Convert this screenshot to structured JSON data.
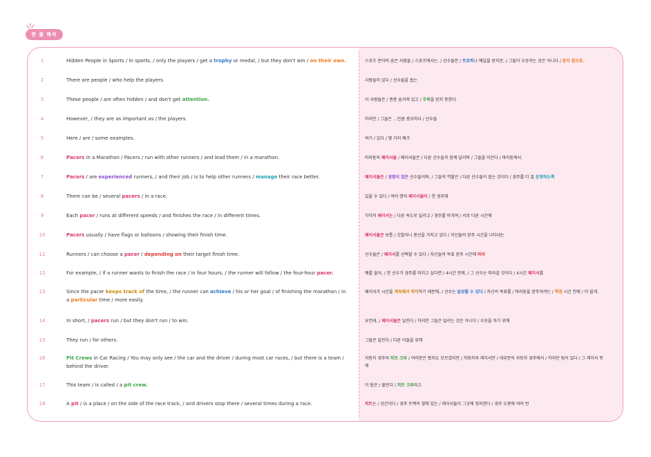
{
  "header": {
    "badge_label": "한 줄 해석"
  },
  "colors": {
    "accent_pink": "#ec8fb3",
    "blue": "#2f78c8",
    "orange": "#f07a1e",
    "green": "#3aa645",
    "pink": "#d9376a",
    "purple": "#8a4ed0",
    "teal": "#1c9fb0",
    "red": "#e03a3a",
    "gold": "#c98a10"
  },
  "rows": [
    {
      "num": "1",
      "en": [
        {
          "t": "Hidden People in Sports / In sports, / only the players / get a "
        },
        {
          "t": "trophy",
          "c": "blue"
        },
        {
          "t": " or medal, / but they don't win / "
        },
        {
          "t": "on their own.",
          "c": "orange"
        }
      ],
      "ko": [
        {
          "t": "스포츠 분야의 숨은 사람들 / 스포츠에서는, / 선수들만 / "
        },
        {
          "t": "트로피",
          "c": "blue"
        },
        {
          "t": "나 메달을 받지만, / 그들이 우승하는 것은 아니다 / "
        },
        {
          "t": "혼자 힘으로.",
          "c": "orange"
        }
      ]
    },
    {
      "num": "2",
      "en": [
        {
          "t": "There are people / who help the players."
        }
      ],
      "ko": [
        {
          "t": "사람들이 있다 / 선수들을 돕는"
        }
      ]
    },
    {
      "num": "3",
      "en": [
        {
          "t": "These people / are often hidden / and don't get "
        },
        {
          "t": "attention.",
          "c": "green"
        }
      ],
      "ko": [
        {
          "t": "이 사람들은 / 종종 숨겨져 있고 / "
        },
        {
          "t": "주목",
          "c": "green"
        },
        {
          "t": "을 받지 못한다."
        }
      ]
    },
    {
      "num": "4",
      "en": [
        {
          "t": "However, / they are as important as / the players."
        }
      ],
      "ko": [
        {
          "t": "하지만 / 그들은 …만큼 중요하다 / 선수들"
        }
      ]
    },
    {
      "num": "5",
      "en": [
        {
          "t": "Here / are / some examples."
        }
      ],
      "ko": [
        {
          "t": "여기 / 있다 / 몇 가지 예가"
        }
      ]
    },
    {
      "num": "6",
      "en": [
        {
          "t": "Pacers",
          "c": "pink"
        },
        {
          "t": " in a Marathon / Pacers / run with other runners / and lead them / in a marathon."
        }
      ],
      "ko": [
        {
          "t": "마라톤의 "
        },
        {
          "t": "페이서들",
          "c": "pink"
        },
        {
          "t": " / 페이서들은 / 다른 선수들과 함께 달리며 / 그들을 이끈다 / 마라톤에서."
        }
      ]
    },
    {
      "num": "7",
      "en": [
        {
          "t": "Pacers",
          "c": "pink"
        },
        {
          "t": " / are "
        },
        {
          "t": "experienced",
          "c": "purple"
        },
        {
          "t": " runners, / and their job / is to help other runners / "
        },
        {
          "t": "manage",
          "c": "teal"
        },
        {
          "t": " their race better."
        }
      ],
      "ko": [
        {
          "t": "페이서들은",
          "c": "pink"
        },
        {
          "t": " / "
        },
        {
          "t": "경험이 많은",
          "c": "purple"
        },
        {
          "t": " 선수들이며, / 그들의 역할은 / 다른 선수들이 돕는 것이다 / 경주를 더 잘 "
        },
        {
          "t": "운영하도록",
          "c": "teal"
        }
      ]
    },
    {
      "num": "8",
      "en": [
        {
          "t": "There can be / several "
        },
        {
          "t": "pacers",
          "c": "pink"
        },
        {
          "t": " / in a race."
        }
      ],
      "ko": [
        {
          "t": "있을 수 있다 / 여러 명의 "
        },
        {
          "t": "페이서들이",
          "c": "pink"
        },
        {
          "t": " / 한 경주에"
        }
      ]
    },
    {
      "num": "9",
      "en": [
        {
          "t": "Each "
        },
        {
          "t": "pacer",
          "c": "pink"
        },
        {
          "t": " / runs at different speeds / and finishes the race / in different times."
        }
      ],
      "ko": [
        {
          "t": "각각의 "
        },
        {
          "t": "페이서는",
          "c": "pink"
        },
        {
          "t": " / 다른 속도로 달리고 / 경주를 마치며 / 서로 다른 시간에"
        }
      ]
    },
    {
      "num": "10",
      "en": [
        {
          "t": "Pacers",
          "c": "pink"
        },
        {
          "t": " usually / have flags or balloons / showing their finish time."
        }
      ],
      "ko": [
        {
          "t": "페이서들은",
          "c": "pink"
        },
        {
          "t": " 보통 / 깃발이나 풍선을 가지고 있다 / 자신들의 완주 시간을 나타내는"
        }
      ]
    },
    {
      "num": "11",
      "en": [
        {
          "t": "Runners / can choose a "
        },
        {
          "t": "pacer",
          "c": "pink"
        },
        {
          "t": " / "
        },
        {
          "t": "depending on",
          "c": "red"
        },
        {
          "t": " their target finish time."
        }
      ],
      "ko": [
        {
          "t": "선수들은 / "
        },
        {
          "t": "페이서",
          "c": "pink"
        },
        {
          "t": "를 선택할 수 있다 / 자신들의 목표 완주 시간에 "
        },
        {
          "t": "따라",
          "c": "red"
        }
      ]
    },
    {
      "num": "12",
      "en": [
        {
          "t": "For example, / if a runner wants to finish the race / in four hours, / the runner will follow / the four-hour "
        },
        {
          "t": "pacer.",
          "c": "pink"
        }
      ],
      "ko": [
        {
          "t": "예를 들어, / 한 선수가 경주를 마치고 싶다면 / 4시간 안에, / 그 선수는 따라갈 것이다 / 4시간 "
        },
        {
          "t": "페이서",
          "c": "pink"
        },
        {
          "t": "를"
        }
      ]
    },
    {
      "num": "13",
      "en": [
        {
          "t": "Since the pacer "
        },
        {
          "t": "keeps track of",
          "c": "gold"
        },
        {
          "t": " the time, / the runner can "
        },
        {
          "t": "achieve",
          "c": "blue"
        },
        {
          "t": " / his or her goal / of finishing the marathon / in a "
        },
        {
          "t": "particular",
          "c": "orange"
        },
        {
          "t": " time / more easily."
        }
      ],
      "ko": [
        {
          "t": "페이서가 시간을 "
        },
        {
          "t": "계속해서 파악",
          "c": "gold"
        },
        {
          "t": "하기 때문에, / 선수는 "
        },
        {
          "t": "달성할 수 있다",
          "c": "blue"
        },
        {
          "t": " / 자신의 목표를 / 마라톤을 완주하려는 / "
        },
        {
          "t": "특정",
          "c": "orange"
        },
        {
          "t": " 시간 안에 / 더 쉽게."
        }
      ]
    },
    {
      "num": "14",
      "en": [
        {
          "t": "In short, / "
        },
        {
          "t": "pacers",
          "c": "pink"
        },
        {
          "t": " run / but they don't run / to win."
        }
      ],
      "ko": [
        {
          "t": "요컨대, / "
        },
        {
          "t": "페이서들은",
          "c": "pink"
        },
        {
          "t": " 달린다 / 하지만 그들은 달리는 것은 아니다 / 우승을 하기 위해"
        }
      ]
    },
    {
      "num": "15",
      "en": [
        {
          "t": "They run / for others."
        }
      ],
      "ko": [
        {
          "t": "그들은 달린다 / 다른 이들을 위해"
        }
      ]
    },
    {
      "num": "16",
      "en": [
        {
          "t": "Pit Crews",
          "c": "green"
        },
        {
          "t": " in Car Racing / You may only see / the car and the driver / during most car races, / but there is a team / behind the driver."
        }
      ],
      "ko": [
        {
          "t": "자동차 경주의 "
        },
        {
          "t": "피트 크루",
          "c": "green"
        },
        {
          "t": " / 여러분은 봤지도 모르겠지만 / 자동차와 레이서만 / 대부분의 자동차 경주에서 / 하지만 팀이 있다 / 그 레이서 뒤에"
        }
      ]
    },
    {
      "num": "17",
      "en": [
        {
          "t": "This team / is called / a "
        },
        {
          "t": "pit crew.",
          "c": "green"
        }
      ],
      "ko": [
        {
          "t": "이 팀은 / 불린다 / "
        },
        {
          "t": "피트 크루",
          "c": "green"
        },
        {
          "t": "라고"
        }
      ]
    },
    {
      "num": "18",
      "en": [
        {
          "t": "A "
        },
        {
          "t": "pit",
          "c": "pink"
        },
        {
          "t": " / is a place / on the side of the race track, / and drivers stop there / several times during a race."
        }
      ],
      "ko": [
        {
          "t": "피트",
          "c": "pink"
        },
        {
          "t": "는 / 공간이다 / 경주 트랙의 옆에 있는 / 레이서들이 그곳에 정지한다 / 경주 도중에 여러 번"
        }
      ]
    }
  ]
}
